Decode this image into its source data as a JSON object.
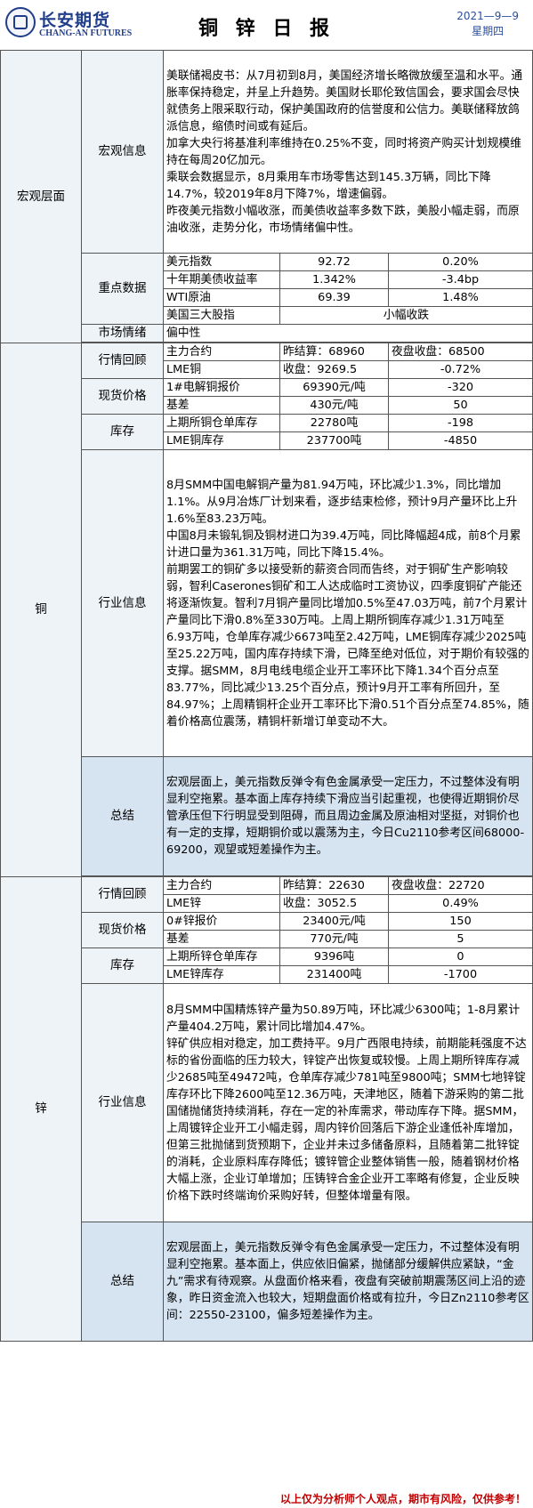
{
  "header": {
    "logo_cn": "长安期货",
    "logo_en": "CHANG-AN FUTURES",
    "title": "铜 锌 日 报",
    "date": "2021—9—9",
    "weekday": "星期四"
  },
  "macro": {
    "section": "宏观层面",
    "info_label": "宏观信息",
    "paragraphs": [
      "美联储褐皮书：从7月初到8月，美国经济增长略微放缓至温和水平。通胀率保持稳定，并呈上升趋势。美国财长耶伦致信国会，要求国会尽快就债务上限采取行动，保护美国政府的信誉度和公信力。美联储释放鸽派信息，缩债时间或有延后。",
      "加拿大央行将基准利率维持在0.25%不变，同时将资产购买计划规模维持在每周20亿加元。",
      "乘联会数据显示，8月乘用车市场零售达到145.3万辆，同比下降14.7%，较2019年8月下降7%，增速偏弱。",
      "昨夜美元指数小幅收涨，而美债收益率多数下跌，美股小幅走弱，而原油收涨，走势分化，市场情绪偏中性。"
    ],
    "key_label": "重点数据",
    "key_rows": [
      {
        "name": "美元指数",
        "value": "92.72",
        "change": "0.20%"
      },
      {
        "name": "十年期美债收益率",
        "value": "1.342%",
        "change": "-3.4bp"
      },
      {
        "name": "WTI原油",
        "value": "69.39",
        "change": "1.48%"
      }
    ],
    "stocks_name": "美国三大股指",
    "stocks_value": "小幅收跌",
    "sentiment_label": "市场情绪",
    "sentiment_value": "偏中性"
  },
  "copper": {
    "section": "铜",
    "review_label": "行情回顾",
    "review_rows": [
      {
        "name": "主力合约",
        "a": "昨结算：68960",
        "b": "夜盘收盘：68500"
      },
      {
        "name": "LME铜",
        "a": "收盘：9269.5",
        "b": "-0.72%"
      }
    ],
    "spot_label": "现货价格",
    "spot_rows": [
      {
        "name": "1#电解铜报价",
        "a": "69390元/吨",
        "b": "-320"
      },
      {
        "name": "基差",
        "a": "430元/吨",
        "b": "50"
      }
    ],
    "stock_label": "库存",
    "stock_rows": [
      {
        "name": "上期所铜仓单库存",
        "a": "22780吨",
        "b": "-198"
      },
      {
        "name": "LME铜库存",
        "a": "237700吨",
        "b": "-4850"
      }
    ],
    "industry_label": "行业信息",
    "industry_paragraphs": [
      "8月SMM中国电解铜产量为81.94万吨，环比减少1.3%，同比增加1.1%。从9月冶炼厂计划来看，逐步结束检修，预计9月产量环比上升1.6%至83.23万吨。",
      "中国8月未锻轧铜及铜材进口为39.4万吨，同比降幅超4成，前8个月累计进口量为361.31万吨，同比下降15.4%。",
      "前期罢工的铜矿多以接受新的薪资合同而告终，对于铜矿生产影响较弱，智利Caserones铜矿和工人达成临时工资协议，四季度铜矿产能还将逐渐恢复。智利7月铜产量同比增加0.5%至47.03万吨，前7个月累计产量同比下滑0.8%至330万吨。上周上期所铜库存减少1.31万吨至6.93万吨，仓单库存减少6673吨至2.42万吨，LME铜库存减少2025吨至25.22万吨，国内库存持续下滑，已降至绝对低位，对于期价有较强的支撑。据SMM，8月电线电缆企业开工率环比下降1.34个百分点至83.77%，同比减少13.25个百分点，预计9月开工率有所回升，至84.97%；上周精铜杆企业开工率环比下滑0.51个百分点至74.85%，随着价格高位震荡，精铜杆新增订单变动不大。"
    ],
    "summary_label": "总结",
    "summary": "宏观层面上，美元指数反弹令有色金属承受一定压力，不过整体没有明显利空拖累。基本面上库存持续下滑应当引起重视，也使得近期铜价尽管承压但下行明显受到阻碍，而且周边金属及原油相对坚挺，对铜价也有一定的支撑，短期铜价或以震荡为主，今日Cu2110参考区间68000-69200，观望或短差操作为主。"
  },
  "zinc": {
    "section": "锌",
    "review_label": "行情回顾",
    "review_rows": [
      {
        "name": "主力合约",
        "a": "昨结算：22630",
        "b": "夜盘收盘：22720"
      },
      {
        "name": "LME锌",
        "a": "收盘：3052.5",
        "b": "0.49%"
      }
    ],
    "spot_label": "现货价格",
    "spot_rows": [
      {
        "name": "0#锌报价",
        "a": "23400元/吨",
        "b": "150"
      },
      {
        "name": "基差",
        "a": "770元/吨",
        "b": "5"
      }
    ],
    "stock_label": "库存",
    "stock_rows": [
      {
        "name": "上期所锌仓单库存",
        "a": "9396吨",
        "b": "0"
      },
      {
        "name": "LME锌库存",
        "a": "231400吨",
        "b": "-1700"
      }
    ],
    "industry_label": "行业信息",
    "industry_paragraphs": [
      "8月SMM中国精炼锌产量为50.89万吨，环比减少6300吨；1-8月累计产量404.2万吨，累计同比增加4.47%。",
      "锌矿供应相对稳定，加工费持平。9月广西限电持续，前期能耗强度不达标的省份面临的压力较大，锌锭产出恢复或较慢。上周上期所锌库存减少2685吨至49472吨，仓单库存减少781吨至9800吨；SMM七地锌锭库存环比下降2600吨至12.36万吨，天津地区，随着下游采购的第二批国储抛储货持续消耗，存在一定的补库需求，带动库存下降。据SMM，上周镀锌企业开工小幅走弱，周内锌价回落后下游企业逢低补库增加，但第三批抛储到货预期下，企业并未过多储备原料，且随着第二批锌锭的消耗，企业原料库存降低；镀锌管企业整体销售一般，随着钢材价格大幅上涨，企业订单增加；压铸锌合金企业开工率略有修复，企业反映价格下跌时终端询价采购好转，但整体增量有限。"
    ],
    "summary_label": "总结",
    "summary": "宏观层面上，美元指数反弹令有色金属承受一定压力，不过整体没有明显利空拖累。基本面上，供应依旧偏紧，抛储部分缓解供应紧缺，“金九”需求有待观察。从盘面价格来看，夜盘有突破前期震荡区间上沿的迹象，昨日资金流入也较大，短期盘面价格或有拉升，今日Zn2110参考区间：22550-23100，偏多短差操作为主。"
  },
  "footer": "以上仅为分析师个人观点，期市有风险，仅供参考！"
}
